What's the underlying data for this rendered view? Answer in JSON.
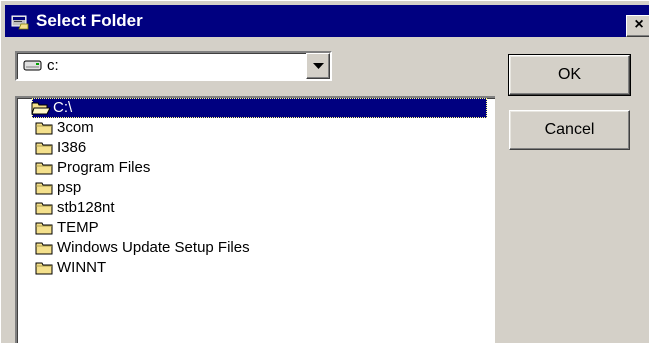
{
  "window": {
    "title": "Select Folder",
    "close_label": "×",
    "title_icon": "folder-window-icon"
  },
  "drive": {
    "selected": "c:",
    "icon": "hard-drive-icon"
  },
  "folders": [
    {
      "label": "C:\\",
      "selected": true,
      "open": true
    },
    {
      "label": "3com"
    },
    {
      "label": "I386"
    },
    {
      "label": "Program Files"
    },
    {
      "label": "psp"
    },
    {
      "label": "stb128nt"
    },
    {
      "label": "TEMP"
    },
    {
      "label": "Windows Update Setup Files"
    },
    {
      "label": "WINNT"
    }
  ],
  "buttons": {
    "ok": "OK",
    "cancel": "Cancel"
  },
  "colors": {
    "titlebar": "#000080",
    "face": "#d4d0c8",
    "selection": "#000080",
    "folder": "#f4e08c"
  }
}
